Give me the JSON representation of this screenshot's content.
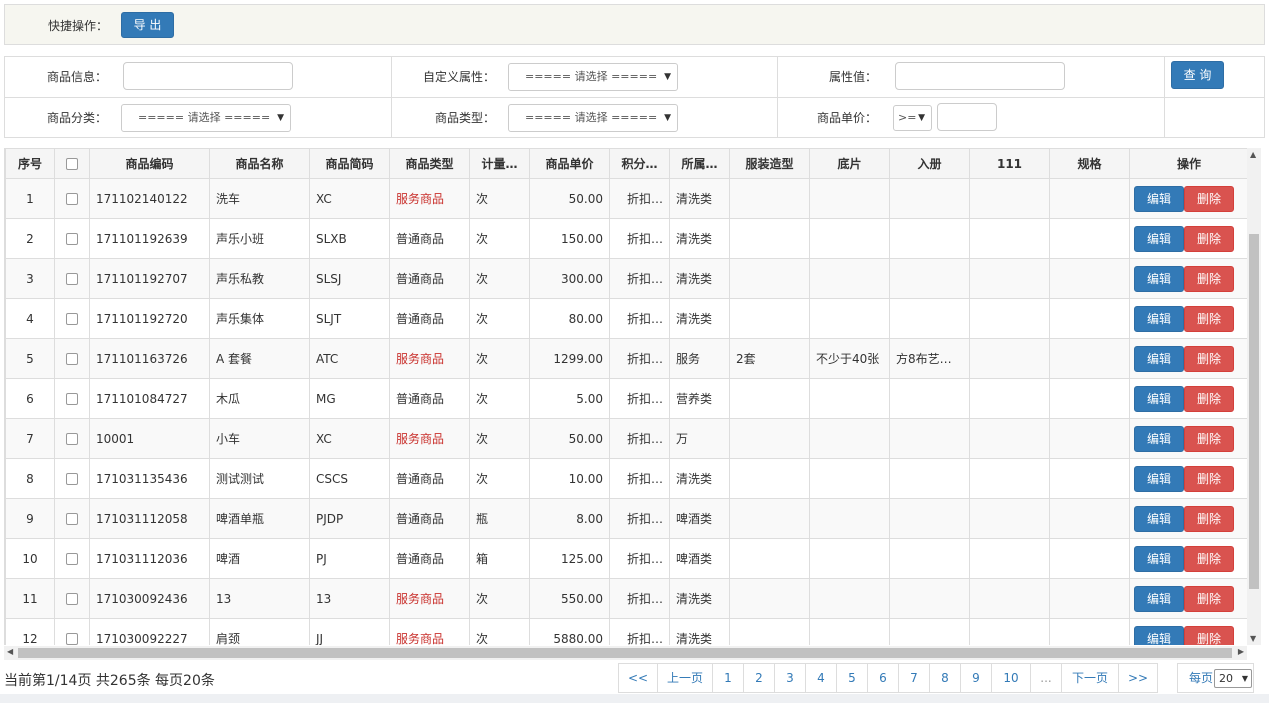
{
  "quick": {
    "label": "快捷操作：",
    "export_label": "导 出"
  },
  "search": {
    "product_info_label": "商品信息：",
    "product_info_value": "",
    "custom_attr_label": "自定义属性：",
    "custom_attr_value": "===== 请选择 =====",
    "attr_value_label": "属性值：",
    "attr_value_value": "",
    "query_label": "查 询",
    "category_label": "商品分类：",
    "category_value": "===== 请选择 =====",
    "type_label": "商品类型：",
    "type_value": "===== 请选择 =====",
    "price_label": "商品单价：",
    "price_op": ">=",
    "price_value": ""
  },
  "table": {
    "headers": [
      "序号",
      "",
      "商品编码",
      "商品名称",
      "商品简码",
      "商品类型",
      "计量…",
      "商品单价",
      "积分…",
      "所属…",
      "服装造型",
      "底片",
      "入册",
      "111",
      "规格",
      "操作"
    ],
    "edit_label": "编辑",
    "delete_label": "删除",
    "rows": [
      {
        "no": "1",
        "code": "171102140122",
        "name": "洗车",
        "short": "XC",
        "type": "服务商品",
        "service": true,
        "unit": "次",
        "price": "50.00",
        "points": "折扣…",
        "cat": "清洗类",
        "cloth": "",
        "film": "",
        "album": "",
        "c111": "",
        "spec": ""
      },
      {
        "no": "2",
        "code": "171101192639",
        "name": "声乐小班",
        "short": "SLXB",
        "type": "普通商品",
        "service": false,
        "unit": "次",
        "price": "150.00",
        "points": "折扣…",
        "cat": "清洗类",
        "cloth": "",
        "film": "",
        "album": "",
        "c111": "",
        "spec": ""
      },
      {
        "no": "3",
        "code": "171101192707",
        "name": "声乐私教",
        "short": "SLSJ",
        "type": "普通商品",
        "service": false,
        "unit": "次",
        "price": "300.00",
        "points": "折扣…",
        "cat": "清洗类",
        "cloth": "",
        "film": "",
        "album": "",
        "c111": "",
        "spec": ""
      },
      {
        "no": "4",
        "code": "171101192720",
        "name": "声乐集体",
        "short": "SLJT",
        "type": "普通商品",
        "service": false,
        "unit": "次",
        "price": "80.00",
        "points": "折扣…",
        "cat": "清洗类",
        "cloth": "",
        "film": "",
        "album": "",
        "c111": "",
        "spec": ""
      },
      {
        "no": "5",
        "code": "171101163726",
        "name": "A 套餐",
        "short": "ATC",
        "type": "服务商品",
        "service": true,
        "unit": "次",
        "price": "1299.00",
        "points": "折扣…",
        "cat": "服务",
        "cloth": "2套",
        "film": "不少于40张",
        "album": "方8布艺相…",
        "c111": "",
        "spec": ""
      },
      {
        "no": "6",
        "code": "171101084727",
        "name": "木瓜",
        "short": "MG",
        "type": "普通商品",
        "service": false,
        "unit": "次",
        "price": "5.00",
        "points": "折扣…",
        "cat": "营养类",
        "cloth": "",
        "film": "",
        "album": "",
        "c111": "",
        "spec": ""
      },
      {
        "no": "7",
        "code": "10001",
        "name": "小车",
        "short": "XC",
        "type": "服务商品",
        "service": true,
        "unit": "次",
        "price": "50.00",
        "points": "折扣…",
        "cat": "万",
        "cloth": "",
        "film": "",
        "album": "",
        "c111": "",
        "spec": ""
      },
      {
        "no": "8",
        "code": "171031135436",
        "name": "测试测试",
        "short": "CSCS",
        "type": "普通商品",
        "service": false,
        "unit": "次",
        "price": "10.00",
        "points": "折扣…",
        "cat": "清洗类",
        "cloth": "",
        "film": "",
        "album": "",
        "c111": "",
        "spec": ""
      },
      {
        "no": "9",
        "code": "171031112058",
        "name": "啤酒单瓶",
        "short": "PJDP",
        "type": "普通商品",
        "service": false,
        "unit": "瓶",
        "price": "8.00",
        "points": "折扣…",
        "cat": "啤酒类",
        "cloth": "",
        "film": "",
        "album": "",
        "c111": "",
        "spec": ""
      },
      {
        "no": "10",
        "code": "171031112036",
        "name": "啤酒",
        "short": "PJ",
        "type": "普通商品",
        "service": false,
        "unit": "箱",
        "price": "125.00",
        "points": "折扣…",
        "cat": "啤酒类",
        "cloth": "",
        "film": "",
        "album": "",
        "c111": "",
        "spec": ""
      },
      {
        "no": "11",
        "code": "171030092436",
        "name": "13",
        "short": "13",
        "type": "服务商品",
        "service": true,
        "unit": "次",
        "price": "550.00",
        "points": "折扣…",
        "cat": "清洗类",
        "cloth": "",
        "film": "",
        "album": "",
        "c111": "",
        "spec": ""
      },
      {
        "no": "12",
        "code": "171030092227",
        "name": "肩颈",
        "short": "JJ",
        "type": "服务商品",
        "service": true,
        "unit": "次",
        "price": "5880.00",
        "points": "折扣…",
        "cat": "清洗类",
        "cloth": "",
        "film": "",
        "album": "",
        "c111": "",
        "spec": ""
      }
    ]
  },
  "footer": {
    "summary": "当前第1/14页 共265条 每页20条",
    "pages": [
      "<<",
      "上一页",
      "1",
      "2",
      "3",
      "4",
      "5",
      "6",
      "7",
      "8",
      "9",
      "10",
      "...",
      "下一页",
      ">>"
    ],
    "per_page_label": "每页",
    "per_page_value": "20"
  },
  "colors": {
    "primary": "#337ab7",
    "danger": "#d9534f",
    "service_text": "#c9302c"
  }
}
